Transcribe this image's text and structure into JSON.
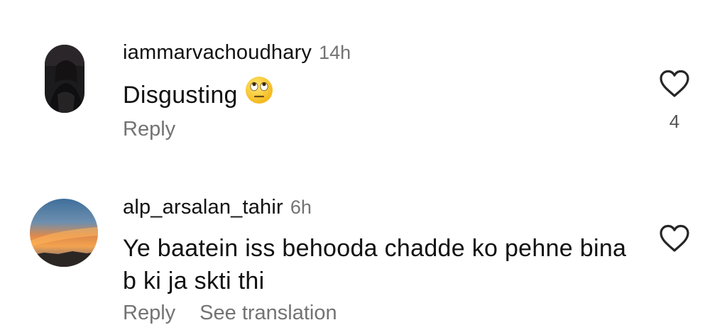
{
  "comments": [
    {
      "username": "iammarvachoudhary",
      "time": "14h",
      "text": "Disgusting",
      "emoji_icon": "face-with-rolling-eyes",
      "reply_label": "Reply",
      "like_count": "4",
      "like_icon": "heart-outline"
    },
    {
      "username": "alp_arsalan_tahir",
      "time": "6h",
      "text": "Ye baatein iss behooda chadde ko pehne bina b ki ja skti thi",
      "like_icon": "heart-outline",
      "reply_label": "Reply",
      "translate_label": "See translation"
    }
  ],
  "colors": {
    "text": "#111111",
    "secondary": "#737373",
    "icon": "#262626"
  }
}
